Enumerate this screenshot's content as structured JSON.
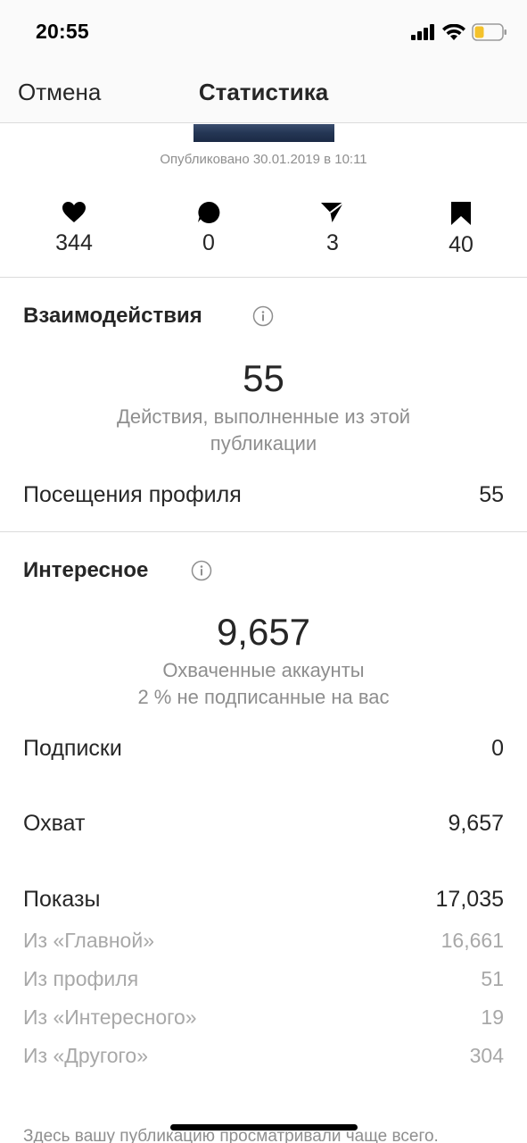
{
  "status_bar": {
    "time": "20:55"
  },
  "nav": {
    "cancel_label": "Отмена",
    "title": "Статистика"
  },
  "post": {
    "published": "Опубликовано 30.01.2019 в 10:11"
  },
  "stats": [
    {
      "icon": "heart-icon",
      "value": "344"
    },
    {
      "icon": "comment-icon",
      "value": "0"
    },
    {
      "icon": "share-icon",
      "value": "3"
    },
    {
      "icon": "bookmark-icon",
      "value": "40"
    }
  ],
  "interactions": {
    "title": "Взаимодействия",
    "number": "55",
    "caption": "Действия, выполненные из этой публикации",
    "rows": [
      {
        "label": "Посещения профиля",
        "value": "55"
      }
    ]
  },
  "discovery": {
    "title": "Интересное",
    "number": "9,657",
    "caption_line1": "Охваченные аккаунты",
    "caption_line2": "2 % не подписанные на вас",
    "rows": [
      {
        "label": "Подписки",
        "value": "0"
      },
      {
        "label": "Охват",
        "value": "9,657"
      },
      {
        "label": "Показы",
        "value": "17,035"
      }
    ],
    "sub_rows": [
      {
        "label": "Из «Главной»",
        "value": "16,661"
      },
      {
        "label": "Из профиля",
        "value": "51"
      },
      {
        "label": "Из «Интересного»",
        "value": "19"
      },
      {
        "label": "Из «Другого»",
        "value": "304"
      }
    ]
  },
  "footer": {
    "note": "Здесь вашу публикацию просматривали чаще всего."
  },
  "colors": {
    "text": "#262626",
    "secondary": "#8e8e8e",
    "divider": "#dbdbdb",
    "battery": "#f4c22b"
  }
}
